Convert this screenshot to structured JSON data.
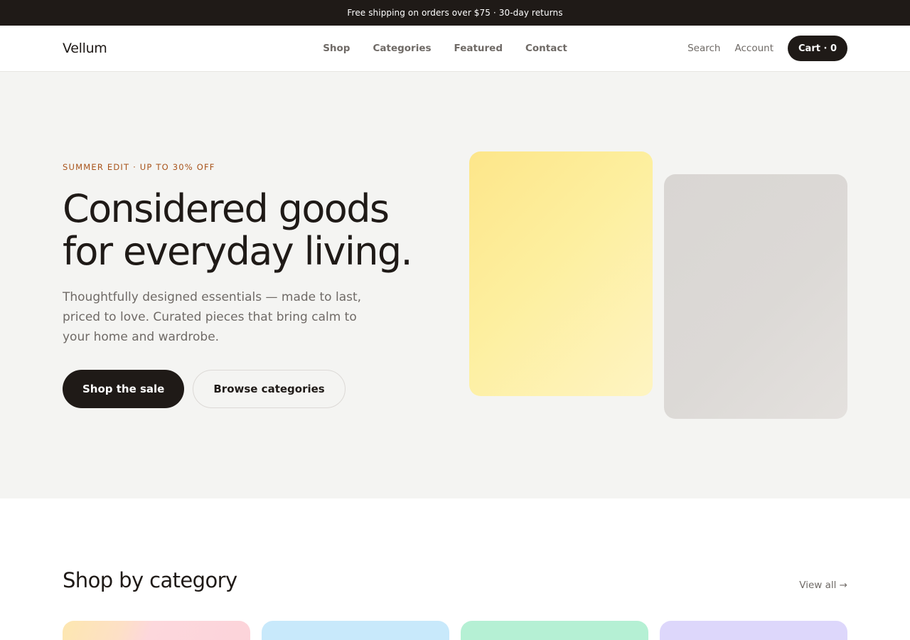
{
  "announcement": {
    "text": "Free shipping on orders over $75 · 30-day returns"
  },
  "header": {
    "logo": "Vellum",
    "nav": [
      {
        "label": "Shop"
      },
      {
        "label": "Categories"
      },
      {
        "label": "Featured"
      },
      {
        "label": "Contact"
      }
    ],
    "search_label": "Search",
    "account_label": "Account",
    "cart_label": "Cart · 0"
  },
  "hero": {
    "eyebrow": "SUMMER EDIT · UP TO 30% OFF",
    "headline_line1": "Considered goods",
    "headline_line2": "for everyday living.",
    "subcopy": "Thoughtfully designed essentials — made to last, priced to love. Curated pieces that bring calm to your home and wardrobe.",
    "primary_cta": "Shop the sale",
    "secondary_cta": "Browse categories"
  },
  "categories": {
    "title": "Shop by category",
    "view_all": "View all →"
  },
  "colors": {
    "brand_dark": "#1f1a17",
    "accent": "#a8531a",
    "muted_text": "#6f6a66",
    "hero_bg": "#f4f4f2"
  }
}
